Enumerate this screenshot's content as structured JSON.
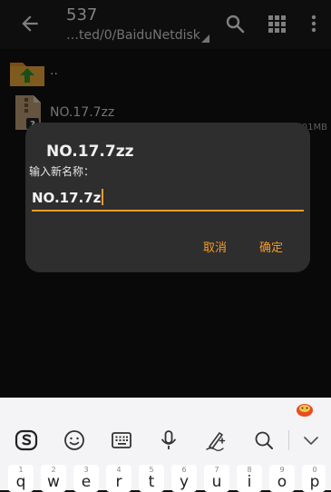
{
  "appbar": {
    "title": "537",
    "subtitle": "…ted/0/BaiduNetdisk",
    "icons": [
      "back-arrow-icon",
      "search-icon",
      "grid-view-icon",
      "more-vert-icon"
    ]
  },
  "file_list": {
    "parent_label": "..",
    "items": [
      {
        "name": "NO.17.7zz",
        "size": "…01MB"
      }
    ]
  },
  "dialog": {
    "title": "NO.17.7zz",
    "label": "输入新名称：",
    "input_value": "NO.17.7z",
    "cancel_label": "取消",
    "confirm_label": "确定",
    "accent_color": "#f39a2b"
  },
  "keyboard": {
    "toolbar_icons": [
      "sogou-logo-icon",
      "emoji-icon",
      "keyboard-icon",
      "microphone-icon",
      "handwriting-icon",
      "search-icon",
      "chevron-down-icon"
    ],
    "keys": [
      {
        "num": "1",
        "letter": "q"
      },
      {
        "num": "2",
        "letter": "w"
      },
      {
        "num": "3",
        "letter": "e"
      },
      {
        "num": "4",
        "letter": "r"
      },
      {
        "num": "5",
        "letter": "t"
      },
      {
        "num": "6",
        "letter": "y"
      },
      {
        "num": "7",
        "letter": "u"
      },
      {
        "num": "8",
        "letter": "i"
      },
      {
        "num": "9",
        "letter": "o"
      },
      {
        "num": "0",
        "letter": "p"
      }
    ]
  }
}
